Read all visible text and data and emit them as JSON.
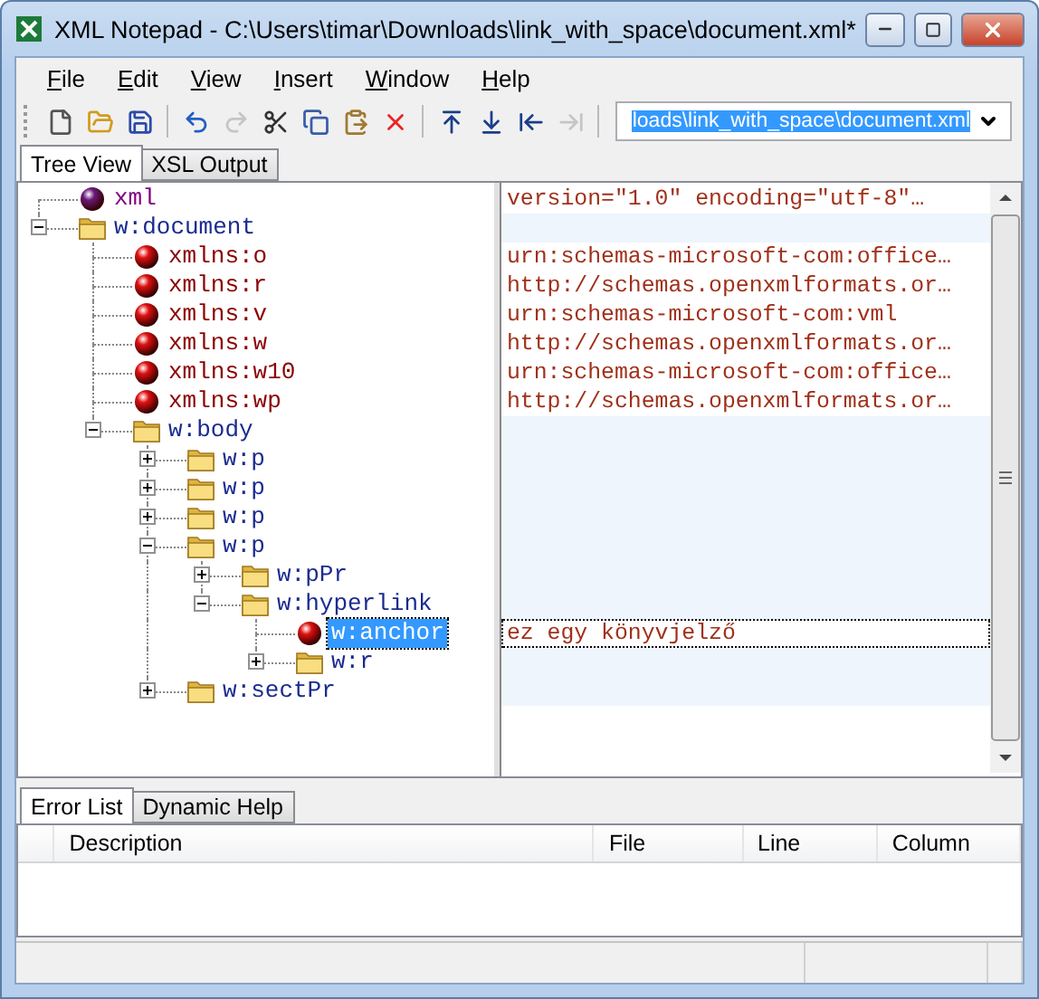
{
  "window": {
    "title": "XML Notepad - C:\\Users\\timar\\Downloads\\link_with_space\\document.xml*"
  },
  "menu": [
    "File",
    "Edit",
    "View",
    "Insert",
    "Window",
    "Help"
  ],
  "toolbar": [
    {
      "kind": "new",
      "disabled": false
    },
    {
      "kind": "open",
      "disabled": false
    },
    {
      "kind": "save",
      "disabled": false
    },
    {
      "kind": "sep"
    },
    {
      "kind": "undo",
      "disabled": false
    },
    {
      "kind": "redo",
      "disabled": true
    },
    {
      "kind": "cut",
      "disabled": false
    },
    {
      "kind": "copy",
      "disabled": false
    },
    {
      "kind": "paste",
      "disabled": false
    },
    {
      "kind": "delete",
      "disabled": false
    },
    {
      "kind": "sep"
    },
    {
      "kind": "nudge-up",
      "disabled": false
    },
    {
      "kind": "nudge-down",
      "disabled": false
    },
    {
      "kind": "nudge-left",
      "disabled": false
    },
    {
      "kind": "nudge-right",
      "disabled": true
    },
    {
      "kind": "sep"
    }
  ],
  "address": {
    "value": "loads\\link_with_space\\document.xml"
  },
  "tabs": [
    {
      "label": "Tree View",
      "selected": true
    },
    {
      "label": "XSL Output",
      "selected": false
    }
  ],
  "tree": [
    {
      "kind": "pi",
      "name": "xml",
      "value": "version=\"1.0\" encoding=\"utf-8\"…",
      "selected": false
    },
    {
      "kind": "element",
      "name": "w:document",
      "expanded": true,
      "selected": false,
      "children": [
        {
          "kind": "attribute",
          "name": "xmlns:o",
          "value": "urn:schemas-microsoft-com:office…",
          "selected": false
        },
        {
          "kind": "attribute",
          "name": "xmlns:r",
          "value": "http://schemas.openxmlformats.or…",
          "selected": false
        },
        {
          "kind": "attribute",
          "name": "xmlns:v",
          "value": "urn:schemas-microsoft-com:vml",
          "selected": false
        },
        {
          "kind": "attribute",
          "name": "xmlns:w",
          "value": "http://schemas.openxmlformats.or…",
          "selected": false
        },
        {
          "kind": "attribute",
          "name": "xmlns:w10",
          "value": "urn:schemas-microsoft-com:office…",
          "selected": false
        },
        {
          "kind": "attribute",
          "name": "xmlns:wp",
          "value": "http://schemas.openxmlformats.or…",
          "selected": false
        },
        {
          "kind": "element",
          "name": "w:body",
          "expanded": true,
          "selected": false,
          "children": [
            {
              "kind": "element",
              "name": "w:p",
              "expanded": false,
              "selected": false
            },
            {
              "kind": "element",
              "name": "w:p",
              "expanded": false,
              "selected": false
            },
            {
              "kind": "element",
              "name": "w:p",
              "expanded": false,
              "selected": false
            },
            {
              "kind": "element",
              "name": "w:p",
              "expanded": true,
              "selected": false,
              "children": [
                {
                  "kind": "element",
                  "name": "w:pPr",
                  "expanded": false,
                  "selected": false
                },
                {
                  "kind": "element",
                  "name": "w:hyperlink",
                  "expanded": true,
                  "selected": false,
                  "children": [
                    {
                      "kind": "attribute",
                      "name": "w:anchor",
                      "value": "ez egy könyvjelző",
                      "selected": true
                    },
                    {
                      "kind": "element",
                      "name": "w:r",
                      "expanded": false,
                      "selected": false
                    }
                  ]
                }
              ]
            },
            {
              "kind": "element",
              "name": "w:sectPr",
              "expanded": false,
              "selected": false
            }
          ]
        }
      ]
    }
  ],
  "bottom_tabs": [
    {
      "label": "Error List",
      "selected": true
    },
    {
      "label": "Dynamic Help",
      "selected": false
    }
  ],
  "error_list": {
    "columns": [
      "Description",
      "File",
      "Line",
      "Column"
    ]
  }
}
